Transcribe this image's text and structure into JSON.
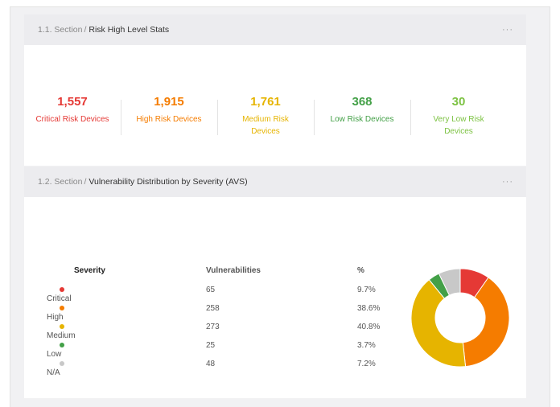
{
  "sections": [
    {
      "crumb": "1.1. Section",
      "title": "Risk High Level Stats",
      "more": "···"
    },
    {
      "crumb": "1.2. Section",
      "title": "Vulnerability Distribution by Severity (AVS)",
      "more": "···"
    }
  ],
  "risk_stats": [
    {
      "value": "1,557",
      "label": "Critical Risk Devices",
      "color": "#e53935"
    },
    {
      "value": "1,915",
      "label": "High Risk Devices",
      "color": "#f57c00"
    },
    {
      "value": "1,761",
      "label": "Medium Risk Devices",
      "color": "#e6b400"
    },
    {
      "value": "368",
      "label": "Low Risk Devices",
      "color": "#43a047"
    },
    {
      "value": "30",
      "label": "Very Low Risk Devices",
      "color": "#7cc242"
    }
  ],
  "severity_table": {
    "headers": [
      "Severity",
      "Vulnerabilities",
      "%"
    ],
    "rows": [
      {
        "severity": "Critical",
        "count": "65",
        "pct": "9.7%",
        "color": "#e53935"
      },
      {
        "severity": "High",
        "count": "258",
        "pct": "38.6%",
        "color": "#f57c00"
      },
      {
        "severity": "Medium",
        "count": "273",
        "pct": "40.8%",
        "color": "#e6b400"
      },
      {
        "severity": "Low",
        "count": "25",
        "pct": "3.7%",
        "color": "#43a047"
      },
      {
        "severity": "N/A",
        "count": "48",
        "pct": "7.2%",
        "color": "#c8c8c8"
      }
    ]
  },
  "chart_data": {
    "type": "pie",
    "donut": true,
    "categories": [
      "Critical",
      "High",
      "Medium",
      "Low",
      "N/A"
    ],
    "values": [
      65,
      258,
      273,
      25,
      48
    ],
    "percent": [
      9.7,
      38.6,
      40.8,
      3.7,
      7.2
    ],
    "colors": [
      "#e53935",
      "#f57c00",
      "#e6b400",
      "#43a047",
      "#c8c8c8"
    ]
  }
}
